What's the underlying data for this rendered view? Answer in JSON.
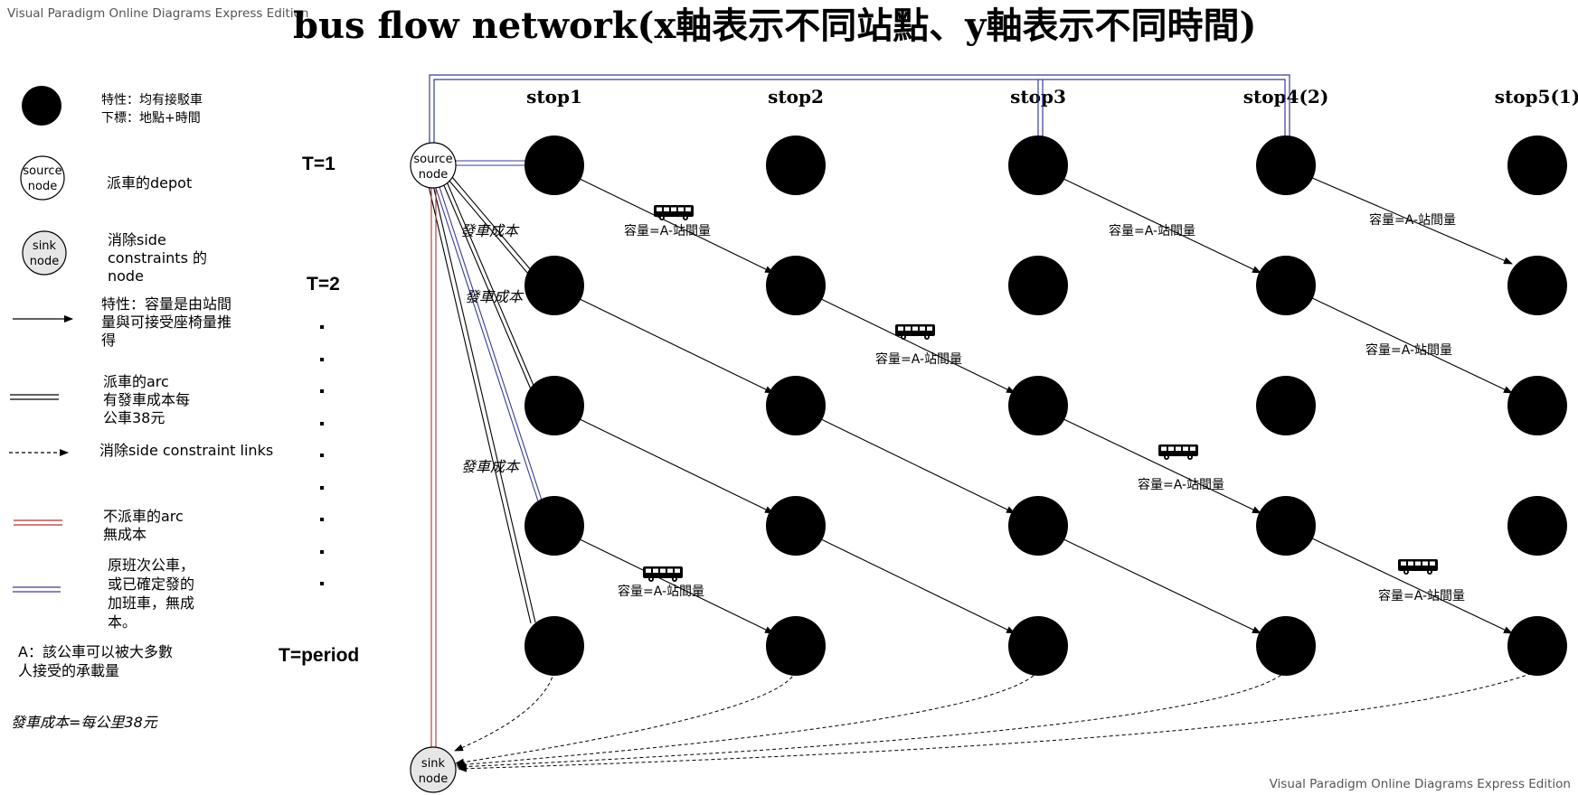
{
  "watermark_top": "Visual Paradigm Online Diagrams Express Edition",
  "watermark_bottom": "Visual Paradigm Online Diagrams Express Edition",
  "title": "bus flow network(x軸表示不同站點、y軸表示不同時間)",
  "stops": [
    "stop1",
    "stop2",
    "stop3",
    "stop4(2)",
    "stop5(1)"
  ],
  "time_labels": {
    "t1": "T=1",
    "t2": "T=2",
    "tp": "T=period"
  },
  "source_node": {
    "line1": "source",
    "line2": "node"
  },
  "sink_node": {
    "line1": "sink",
    "line2": "node"
  },
  "arc_capacity_label": "容量=A-站間量",
  "dispatch_cost_label": "發車成本",
  "legend": {
    "black_node": [
      "特性：均有接駁車",
      "下標：地點+時間"
    ],
    "source_desc": "派車的depot",
    "sink_desc": [
      "消除side",
      "constraints 的",
      "node"
    ],
    "arrow_desc": [
      "特性：容量是由站間",
      "量與可接受座椅量推",
      "得"
    ],
    "double_desc": [
      "派車的arc",
      "有發車成本每",
      "公車38元"
    ],
    "dashed_desc": "消除side constraint links",
    "red_desc": [
      "不派車的arc",
      "無成本"
    ],
    "blue_desc": [
      "原班次公車，",
      "或已確定發的",
      "加班車，無成",
      "本。"
    ],
    "a_def": [
      "A：該公車可以被大多數",
      "人接受的承載量"
    ],
    "cost_note": "發車成本=每公里38元"
  },
  "colors": {
    "node_fill": "#000000",
    "red_arc": "#b03030",
    "blue_arc": "#3a3a9a",
    "special_node_fill": "#e6e6e6"
  }
}
